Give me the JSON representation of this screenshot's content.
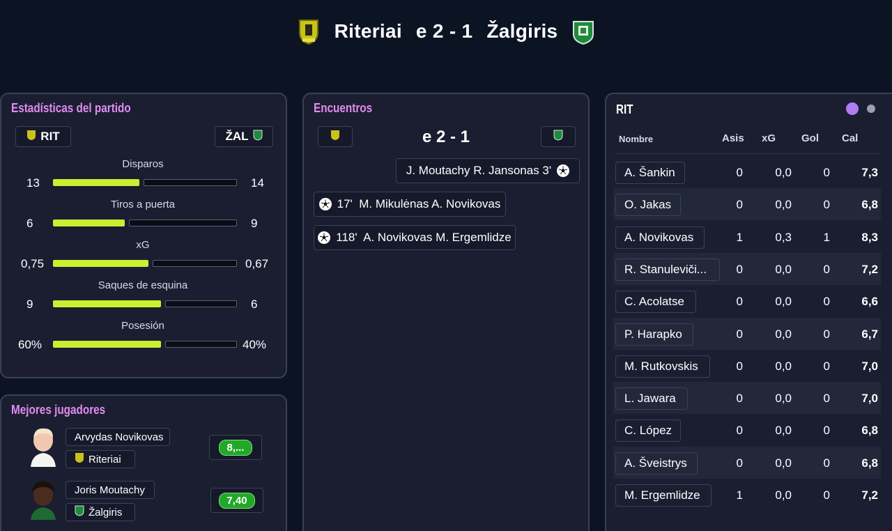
{
  "header": {
    "home": "Riteriai",
    "score": "e 2 - 1",
    "away": "Žalgiris",
    "home_crest": "riteriai-crest",
    "away_crest": "zalgiris-crest"
  },
  "colors": {
    "accent_title": "#e08bf0",
    "bar_fill": "#c8f031",
    "rating_green": "#22a828",
    "dot_active": "#b07cf0",
    "dot_inactive": "#9aa0ae"
  },
  "stats": {
    "title": "Estadísticas del partido",
    "home_abbr": "RIT",
    "away_abbr": "ŽAL",
    "rows": [
      {
        "label": "Disparos",
        "home": "13",
        "away": "14",
        "home_share": 0.48
      },
      {
        "label": "Tiros a puerta",
        "home": "6",
        "away": "9",
        "home_share": 0.4
      },
      {
        "label": "xG",
        "home": "0,75",
        "away": "0,67",
        "home_share": 0.53
      },
      {
        "label": "Saques de esquina",
        "home": "9",
        "away": "6",
        "home_share": 0.6
      },
      {
        "label": "Posesión",
        "home": "60%",
        "away": "40%",
        "home_share": 0.6
      }
    ]
  },
  "best_players": {
    "title": "Mejores jugadores",
    "players": [
      {
        "name": "Arvydas Novikovas",
        "team": "Riteriai",
        "rating": "8,..."
      },
      {
        "name": "Joris Moutachy",
        "team": "Žalgiris",
        "rating": "7,40"
      }
    ]
  },
  "encounters": {
    "title": "Encuentros",
    "score": "e 2 - 1",
    "events": [
      {
        "text": "J. Moutachy R. Jansonas 3'",
        "side": "away",
        "icon": "ball-icon"
      },
      {
        "text": "17'  M. Mikulėnas A. Novikovas",
        "side": "home",
        "icon": "ball-icon"
      },
      {
        "text": "118'  A. Novikovas M. Ergemlidze",
        "side": "home",
        "icon": "ball-icon"
      }
    ]
  },
  "lineup": {
    "team": "RIT",
    "headers": {
      "name": "Nombre",
      "assists": "Asis",
      "xg": "xG",
      "goals": "Gol",
      "rating": "Cal"
    },
    "players": [
      {
        "name": "A. Šankin",
        "asis": "0",
        "xg": "0,0",
        "gol": "0",
        "cal": "7,3"
      },
      {
        "name": "O. Jakas",
        "asis": "0",
        "xg": "0,0",
        "gol": "0",
        "cal": "6,8"
      },
      {
        "name": "A. Novikovas",
        "asis": "1",
        "xg": "0,3",
        "gol": "1",
        "cal": "8,3"
      },
      {
        "name": "R. Stanuleviči...",
        "asis": "0",
        "xg": "0,0",
        "gol": "0",
        "cal": "7,2"
      },
      {
        "name": "C. Acolatse",
        "asis": "0",
        "xg": "0,0",
        "gol": "0",
        "cal": "6,6"
      },
      {
        "name": "P. Harapko",
        "asis": "0",
        "xg": "0,0",
        "gol": "0",
        "cal": "6,7"
      },
      {
        "name": "M. Rutkovskis",
        "asis": "0",
        "xg": "0,0",
        "gol": "0",
        "cal": "7,0"
      },
      {
        "name": "L. Jawara",
        "asis": "0",
        "xg": "0,0",
        "gol": "0",
        "cal": "7,0"
      },
      {
        "name": "C. López",
        "asis": "0",
        "xg": "0,0",
        "gol": "0",
        "cal": "6,8"
      },
      {
        "name": "A. Šveistrys",
        "asis": "0",
        "xg": "0,0",
        "gol": "0",
        "cal": "6,8"
      },
      {
        "name": "M. Ergemlidze",
        "asis": "1",
        "xg": "0,0",
        "gol": "0",
        "cal": "7,2"
      }
    ]
  }
}
